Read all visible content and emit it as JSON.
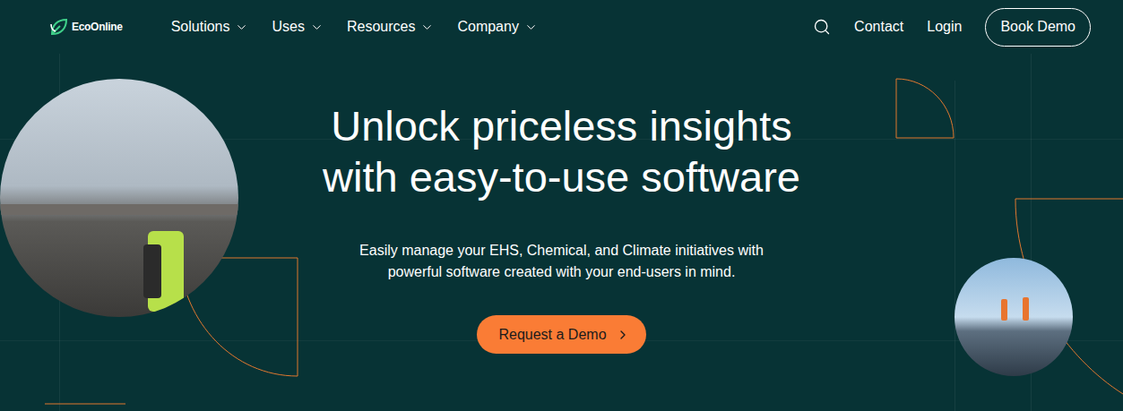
{
  "header": {
    "brand": "EcoOnline",
    "menu": [
      {
        "label": "Solutions"
      },
      {
        "label": "Uses"
      },
      {
        "label": "Resources"
      },
      {
        "label": "Company"
      }
    ],
    "links": [
      "Contact",
      "Login"
    ],
    "cta": "Book Demo"
  },
  "hero": {
    "title_lines": [
      "Unlock priceless insights",
      "with easy-to-use software"
    ],
    "subtitle_lines": [
      "Easily manage your EHS, Chemical, and Climate initiatives with",
      "powerful software created with your end-users in mind."
    ],
    "button": "Request a Demo"
  }
}
